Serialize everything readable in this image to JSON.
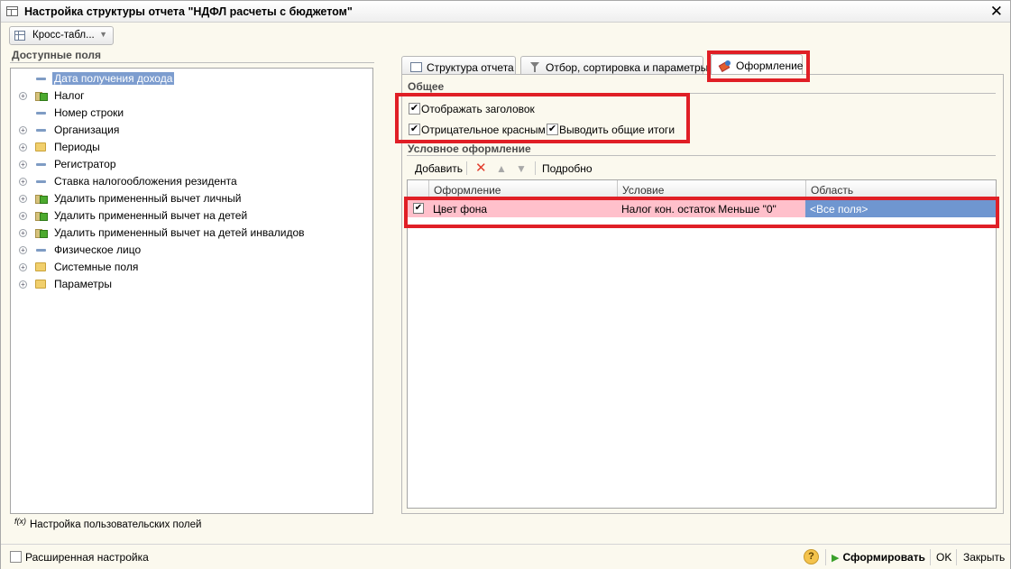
{
  "window": {
    "title": "Настройка структуры отчета \"НДФЛ расчеты с бюджетом\"",
    "close_icon": "close-icon"
  },
  "variant_button": {
    "label": "Кросс-табл..."
  },
  "fields": {
    "title": "Доступные поля",
    "items": [
      {
        "label": "Дата получения дохода",
        "icon": "field-icon",
        "expandable": false,
        "selected": true
      },
      {
        "label": "Налог",
        "icon": "resource-icon",
        "expandable": true,
        "selected": false
      },
      {
        "label": "Номер строки",
        "icon": "field-icon",
        "expandable": false,
        "selected": false
      },
      {
        "label": "Организация",
        "icon": "field-icon",
        "expandable": true,
        "selected": false
      },
      {
        "label": "Периоды",
        "icon": "folder-icon",
        "expandable": true,
        "selected": false
      },
      {
        "label": "Регистратор",
        "icon": "field-icon",
        "expandable": true,
        "selected": false
      },
      {
        "label": "Ставка налогообложения резидента",
        "icon": "field-icon",
        "expandable": true,
        "selected": false
      },
      {
        "label": "Удалить примененный вычет личный",
        "icon": "resource-icon",
        "expandable": true,
        "selected": false
      },
      {
        "label": "Удалить примененный вычет на детей",
        "icon": "resource-icon",
        "expandable": true,
        "selected": false
      },
      {
        "label": "Удалить примененный вычет на детей инвалидов",
        "icon": "resource-icon",
        "expandable": true,
        "selected": false
      },
      {
        "label": "Физическое лицо",
        "icon": "field-icon",
        "expandable": true,
        "selected": false
      },
      {
        "label": "Системные поля",
        "icon": "folder-icon",
        "expandable": true,
        "selected": false
      },
      {
        "label": "Параметры",
        "icon": "folder-icon",
        "expandable": true,
        "selected": false
      }
    ],
    "user_fields_fx": "f(x)",
    "user_fields_label": "Настройка пользовательских полей"
  },
  "tabs": [
    {
      "label": "Структура отчета",
      "active": false
    },
    {
      "label": "Отбор, сортировка и параметры",
      "active": false
    },
    {
      "label": "Оформление",
      "active": true
    }
  ],
  "general": {
    "title": "Общее",
    "show_header": {
      "label": "Отображать заголовок",
      "checked": true
    },
    "negative_red": {
      "label": "Отрицательное красным",
      "checked": true
    },
    "show_totals": {
      "label": "Выводить общие итоги",
      "checked": true
    }
  },
  "conditional": {
    "title": "Условное оформление",
    "toolbar": {
      "add_label": "Добавить",
      "details_label": "Подробно"
    },
    "columns": [
      "Оформление",
      "Условие",
      "Область"
    ],
    "rows": [
      {
        "checked": true,
        "appearance": "Цвет фона",
        "condition": "Налог кон. остаток Меньше \"0\"",
        "area": "<Все поля>"
      }
    ]
  },
  "bottom": {
    "advanced_label": "Расширенная настройка",
    "help_label": "?",
    "run_label": "Сформировать",
    "ok_label": "OK",
    "close_label": "Закрыть"
  },
  "colors": {
    "highlight_row": "#ffc0cb",
    "selection": "#7d9dcf",
    "annotation_box": "#e01f26"
  }
}
